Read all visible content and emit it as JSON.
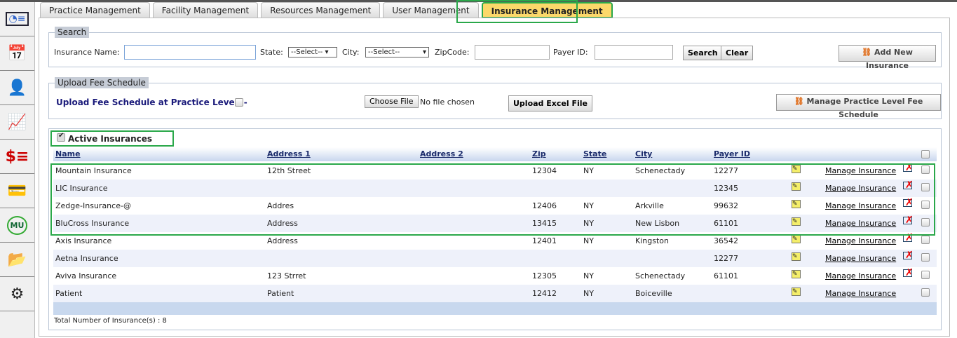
{
  "sidebar": {
    "icons": [
      "presentation-icon",
      "calendar-icon",
      "user-search-icon",
      "monitor-chart-icon",
      "billing-icon",
      "credit-card-icon",
      "mu-icon",
      "folder-docs-icon",
      "admin-gear-icon"
    ]
  },
  "tabs": [
    {
      "label": "Practice Management"
    },
    {
      "label": "Facility Management"
    },
    {
      "label": "Resources Management"
    },
    {
      "label": "User Management"
    },
    {
      "label": "Insurance Management",
      "active": true
    }
  ],
  "search": {
    "legend": "Search",
    "name_label": "Insurance Name:",
    "name_value": "",
    "state_label": "State:",
    "state_value": "--Select--",
    "city_label": "City:",
    "city_value": "--Select--",
    "zip_label": "ZipCode:",
    "payer_label": "Payer ID:",
    "search_btn": "Search",
    "clear_btn": "Clear",
    "add_btn": "Add New Insurance"
  },
  "upload": {
    "legend": "Upload Fee Schedule",
    "label": "Upload Fee Schedule at Practice Level :-",
    "choose_btn": "Choose File",
    "no_file": "No file chosen",
    "upload_btn": "Upload Excel File",
    "manage_btn": "Manage Practice Level Fee Schedule"
  },
  "grid": {
    "active_label": "Active Insurances",
    "active_checked": true,
    "columns": [
      "Name",
      "Address 1",
      "Address 2",
      "Zip",
      "State",
      "City",
      "Payer ID"
    ],
    "rows": [
      {
        "name": "Mountain Insurance",
        "addr1": "12th Street",
        "addr2": "",
        "zip": "12304",
        "state": "NY",
        "city": "Schenectady",
        "payer": "12277",
        "link": "Manage Insurance",
        "delete": true
      },
      {
        "name": "LIC Insurance",
        "addr1": "",
        "addr2": "",
        "zip": "",
        "state": "",
        "city": "",
        "payer": "12345",
        "link": "Manage Insurance",
        "delete": true
      },
      {
        "name": "Zedge-Insurance-@",
        "addr1": "Addres",
        "addr2": "",
        "zip": "12406",
        "state": "NY",
        "city": "Arkville",
        "payer": "99632",
        "link": "Manage Insurance",
        "delete": true
      },
      {
        "name": "BluCross Insurance",
        "addr1": "Address",
        "addr2": "",
        "zip": "13415",
        "state": "NY",
        "city": "New Lisbon",
        "payer": "61101",
        "link": "Manage Insurance",
        "delete": true
      },
      {
        "name": "Axis Insurance",
        "addr1": "Address",
        "addr2": "",
        "zip": "12401",
        "state": "NY",
        "city": "Kingston",
        "payer": "36542",
        "link": "Manage Insurance",
        "delete": true
      },
      {
        "name": "Aetna Insurance",
        "addr1": "",
        "addr2": "",
        "zip": "",
        "state": "",
        "city": "",
        "payer": "12277",
        "link": "Manage Insurance",
        "delete": true
      },
      {
        "name": "Aviva Insurance",
        "addr1": "123 Strret",
        "addr2": "",
        "zip": "12305",
        "state": "NY",
        "city": "Schenectady",
        "payer": "61101",
        "link": "Manage Insurance",
        "delete": true
      },
      {
        "name": "Patient",
        "addr1": "Patient",
        "addr2": "",
        "zip": "12412",
        "state": "NY",
        "city": "Boiceville",
        "payer": "",
        "link": "Manage Insurance",
        "delete": false
      }
    ],
    "total": "Total Number of Insurance(s) : 8"
  },
  "colors": {
    "highlight": "#2aa84a",
    "active_tab": "#fbd86a",
    "header_text": "#1a2a6a"
  }
}
